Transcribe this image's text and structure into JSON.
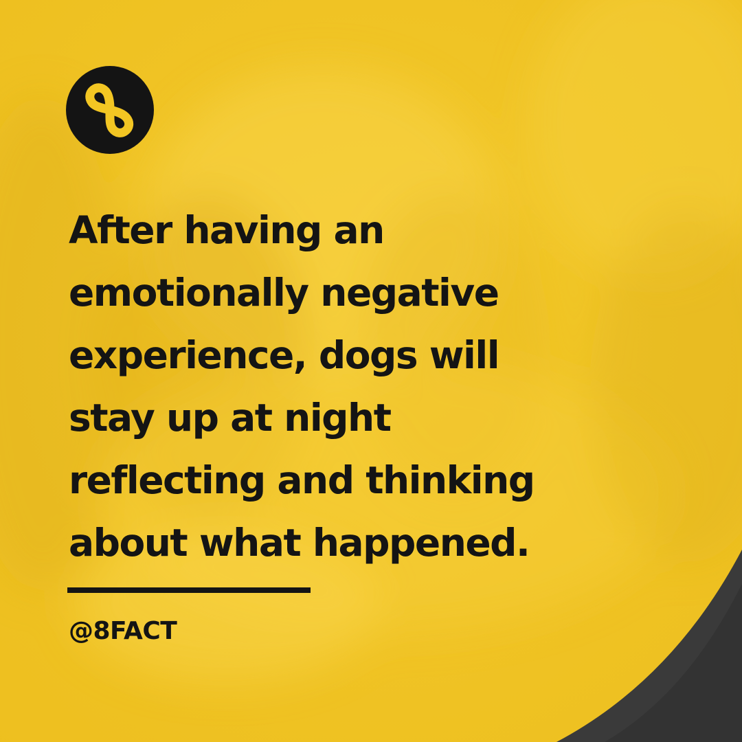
{
  "brand": {
    "logo_icon": "infinity-eight-icon",
    "handle": "@8FACT"
  },
  "fact": {
    "lines": [
      "After having an",
      "emotionally negative",
      "experience, dogs will",
      "stay up at night",
      "reflecting and thinking",
      "about what happened."
    ]
  },
  "colors": {
    "background": "#f3c623",
    "text": "#141414",
    "corner": "#3a3a3a"
  }
}
